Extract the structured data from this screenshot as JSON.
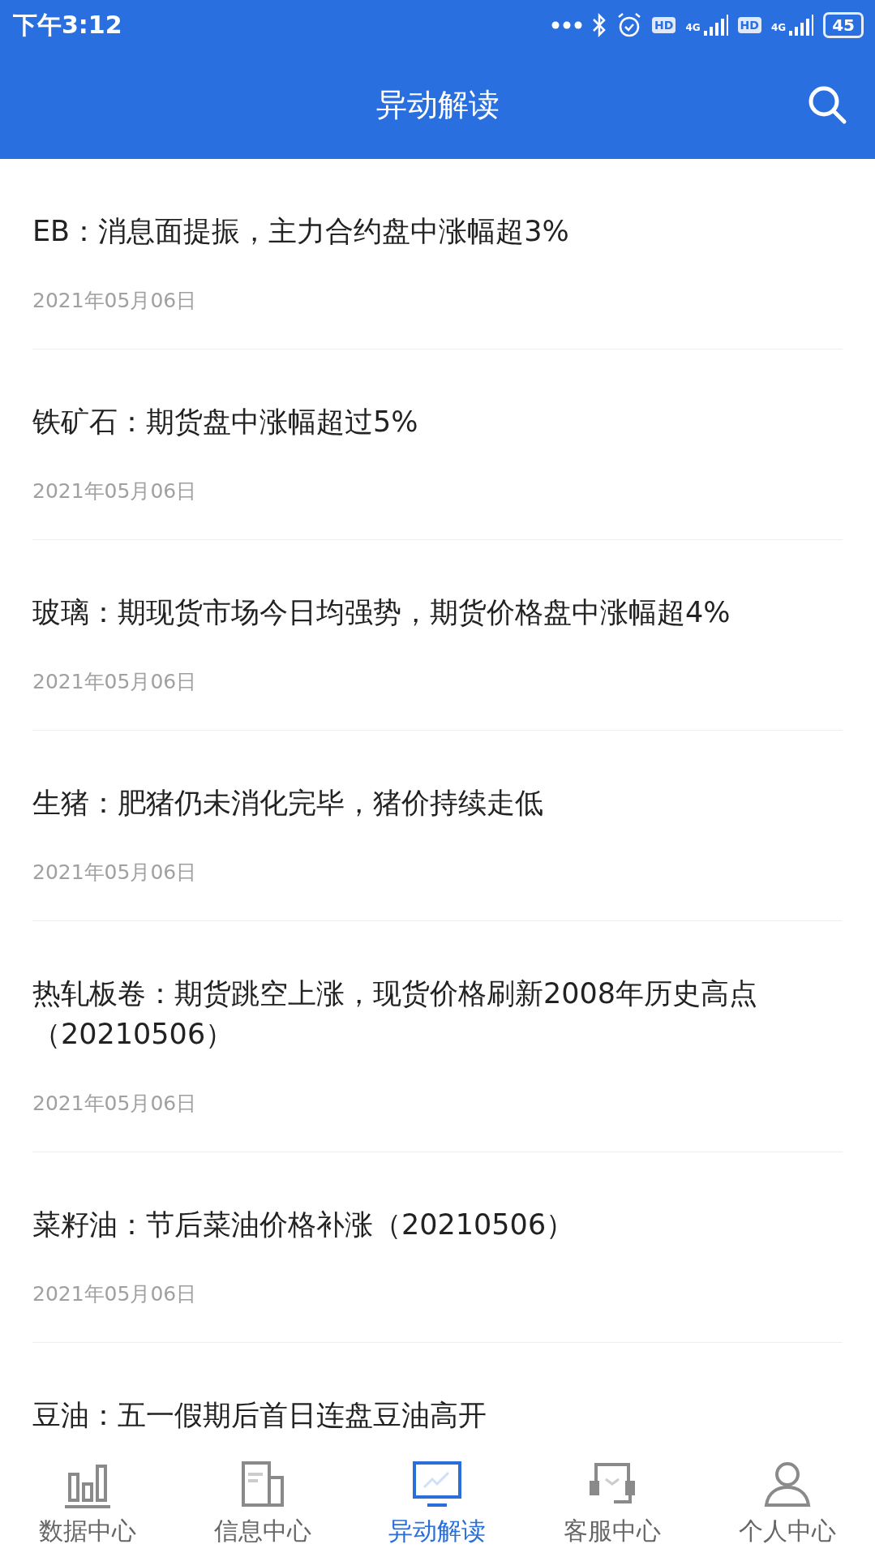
{
  "status_bar": {
    "time": "下午3:12",
    "sims": [
      {
        "hd": "HD",
        "network": "4G"
      },
      {
        "hd": "HD",
        "network": "4G"
      }
    ],
    "battery": "45"
  },
  "header": {
    "title": "异动解读"
  },
  "articles": [
    {
      "title": "EB：消息面提振，主力合约盘中涨幅超3%",
      "date": "2021年05月06日"
    },
    {
      "title": "铁矿石：期货盘中涨幅超过5%",
      "date": "2021年05月06日"
    },
    {
      "title": "玻璃：期现货市场今日均强势，期货价格盘中涨幅超4%",
      "date": "2021年05月06日"
    },
    {
      "title": "生猪：肥猪仍未消化完毕，猪价持续走低",
      "date": "2021年05月06日"
    },
    {
      "title": "热轧板卷：期货跳空上涨，现货价格刷新2008年历史高点（20210506）",
      "date": "2021年05月06日"
    },
    {
      "title": "菜籽油：节后菜油价格补涨（20210506）",
      "date": "2021年05月06日"
    },
    {
      "title": "豆油：五一假期后首日连盘豆油高开"
    }
  ],
  "tab_bar": [
    {
      "kind": "chart",
      "label": "数据中心",
      "selected": false
    },
    {
      "kind": "document",
      "label": "信息中心",
      "selected": false
    },
    {
      "kind": "monitor",
      "label": "异动解读",
      "selected": true
    },
    {
      "kind": "headset",
      "label": "客服中心",
      "selected": false
    },
    {
      "kind": "person",
      "label": "个人中心",
      "selected": false
    }
  ]
}
